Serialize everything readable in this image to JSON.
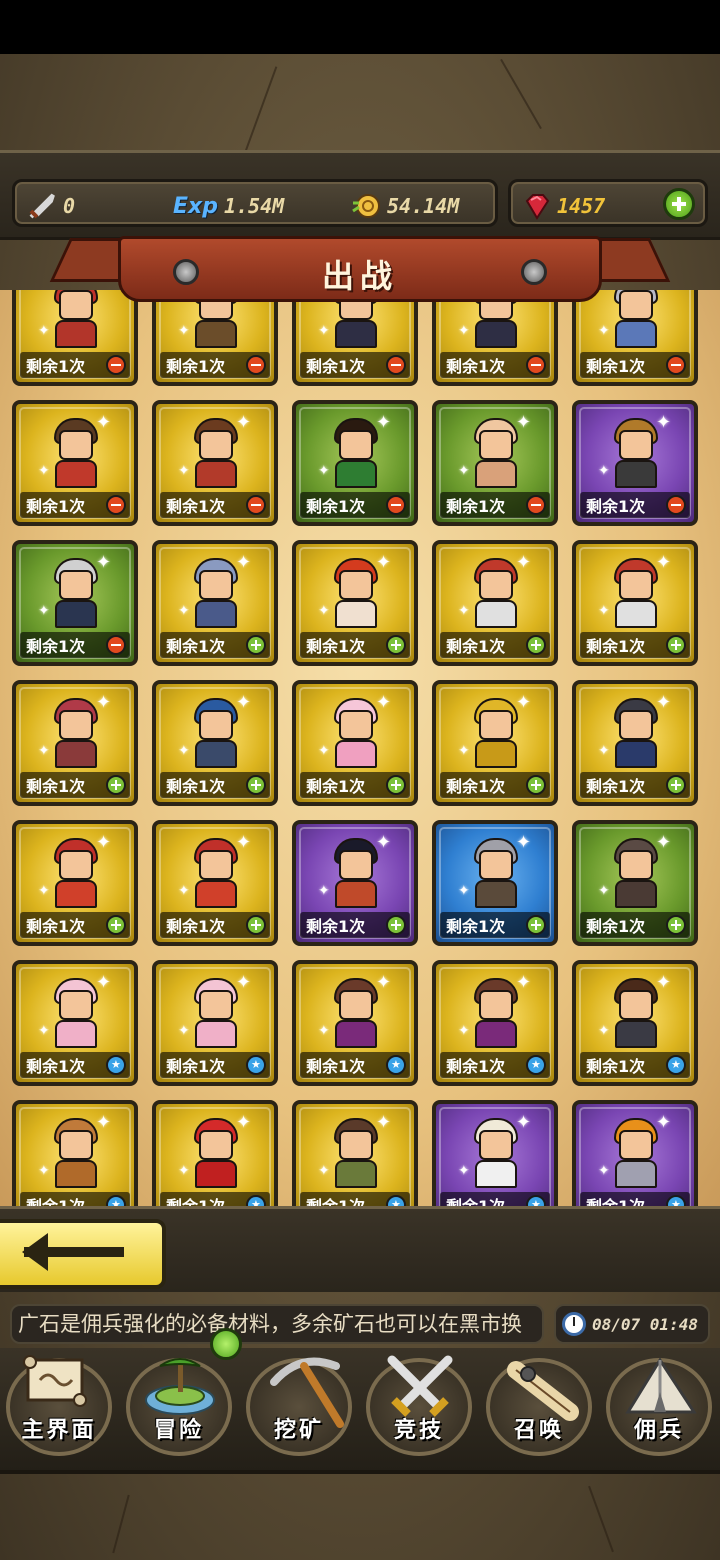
{
  "resources": {
    "attack": "0",
    "exp_label": "Exp",
    "exp": "1.54M",
    "gold": "54.14M",
    "gems": "1457"
  },
  "title": "出战",
  "card_label": "剩余1次",
  "cards": [
    {
      "frame": "gold",
      "badge": "red",
      "hair": "#c0322a",
      "outfit": "#b2352a"
    },
    {
      "frame": "gold",
      "badge": "red",
      "hair": "#e9c25a",
      "outfit": "#6b4d2a"
    },
    {
      "frame": "gold",
      "badge": "red",
      "hair": "#3b4a8a",
      "outfit": "#2e2e44"
    },
    {
      "frame": "gold",
      "badge": "red",
      "hair": "#3b4a8a",
      "outfit": "#2e2e44"
    },
    {
      "frame": "gold",
      "badge": "red",
      "hair": "#b9b9c6",
      "outfit": "#5b78b8"
    },
    {
      "frame": "gold",
      "badge": "red",
      "hair": "#5a3a22",
      "outfit": "#c0392b"
    },
    {
      "frame": "gold",
      "badge": "red",
      "hair": "#6b3b1f",
      "outfit": "#b23a2a"
    },
    {
      "frame": "green",
      "badge": "red",
      "hair": "#2a1a10",
      "outfit": "#2e7d32"
    },
    {
      "frame": "green",
      "badge": "red",
      "hair": "#f0c7a0",
      "outfit": "#d9a17a"
    },
    {
      "frame": "purple",
      "badge": "red",
      "hair": "#b07a2a",
      "outfit": "#3a3a3a"
    },
    {
      "frame": "green",
      "badge": "red",
      "hair": "#d0d0d0",
      "outfit": "#2a3550"
    },
    {
      "frame": "gold",
      "badge": "green",
      "hair": "#8a9ac0",
      "outfit": "#4a5a8a"
    },
    {
      "frame": "gold",
      "badge": "green",
      "hair": "#d43b1e",
      "outfit": "#f0e0d0"
    },
    {
      "frame": "gold",
      "badge": "green",
      "hair": "#c0392b",
      "outfit": "#e0e0e0"
    },
    {
      "frame": "gold",
      "badge": "green",
      "hair": "#c0392b",
      "outfit": "#e0e0e0"
    },
    {
      "frame": "gold",
      "badge": "green",
      "hair": "#b03a48",
      "outfit": "#8a3a3a"
    },
    {
      "frame": "gold",
      "badge": "green",
      "hair": "#2a5aa0",
      "outfit": "#3a4a6a"
    },
    {
      "frame": "gold",
      "badge": "green",
      "hair": "#f6c6d8",
      "outfit": "#f0a0c0"
    },
    {
      "frame": "gold",
      "badge": "green",
      "hair": "#e0b628",
      "outfit": "#c89a18"
    },
    {
      "frame": "gold",
      "badge": "green",
      "hair": "#3a3a44",
      "outfit": "#2a3a6a"
    },
    {
      "frame": "gold",
      "badge": "green",
      "hair": "#c0302a",
      "outfit": "#d0402a"
    },
    {
      "frame": "gold",
      "badge": "green",
      "hair": "#c0302a",
      "outfit": "#d0402a"
    },
    {
      "frame": "purple",
      "badge": "green",
      "hair": "#1a1a2a",
      "outfit": "#c04a2a"
    },
    {
      "frame": "blue",
      "badge": "green",
      "hair": "#a0a0a8",
      "outfit": "#5a4a3a"
    },
    {
      "frame": "green",
      "badge": "green",
      "hair": "#5a4a44",
      "outfit": "#4a3a34"
    },
    {
      "frame": "gold",
      "badge": "blue",
      "hair": "#f4c4d4",
      "outfit": "#f0b0c8"
    },
    {
      "frame": "gold",
      "badge": "blue",
      "hair": "#f4c4d4",
      "outfit": "#f0b0c8"
    },
    {
      "frame": "gold",
      "badge": "blue",
      "hair": "#6a3a2a",
      "outfit": "#7a2a7a"
    },
    {
      "frame": "gold",
      "badge": "blue",
      "hair": "#6a3a2a",
      "outfit": "#7a2a7a"
    },
    {
      "frame": "gold",
      "badge": "blue",
      "hair": "#4a2a1a",
      "outfit": "#3a3a44"
    },
    {
      "frame": "gold",
      "badge": "blue",
      "hair": "#c07a3a",
      "outfit": "#b06a2a"
    },
    {
      "frame": "gold",
      "badge": "blue",
      "hair": "#d42a2a",
      "outfit": "#c02020"
    },
    {
      "frame": "gold",
      "badge": "blue",
      "hair": "#5a3a2a",
      "outfit": "#6a7a3a"
    },
    {
      "frame": "purple",
      "badge": "blue",
      "hair": "#f0ead8",
      "outfit": "#f0f0f0"
    },
    {
      "frame": "purple",
      "badge": "blue",
      "hair": "#e8901a",
      "outfit": "#a0a0b0"
    }
  ],
  "ticker": "广石是佣兵强化的必备材料，多余矿石也可以在黑市换",
  "clock": "08/07 01:48",
  "nav": [
    {
      "label": "主界面",
      "icon": "map-scroll-icon"
    },
    {
      "label": "冒险",
      "icon": "island-icon"
    },
    {
      "label": "挖矿",
      "icon": "pickaxe-icon"
    },
    {
      "label": "竞技",
      "icon": "crossed-swords-icon"
    },
    {
      "label": "召唤",
      "icon": "summon-scroll-icon"
    },
    {
      "label": "佣兵",
      "icon": "tent-icon"
    }
  ]
}
